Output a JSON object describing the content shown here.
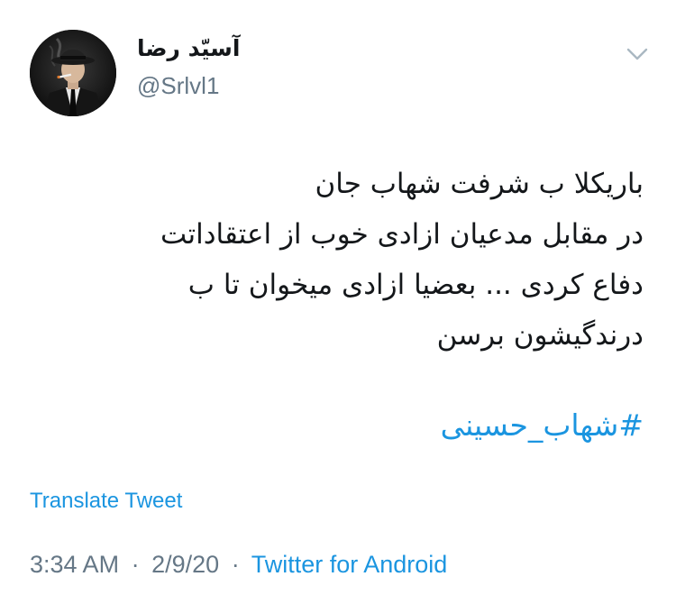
{
  "user": {
    "display_name": "آسیّد رضا",
    "handle": "@Srlvl1"
  },
  "icons": {
    "menu": "chevron-down-icon",
    "avatar": "avatar"
  },
  "tweet": {
    "lines": [
      "باریکلا ب شرفت شهاب جان",
      "در مقابل مدعیان ازادی خوب از اعتقاداتت",
      "دفاع کردی ... بعضیا ازادی میخوان تا ب",
      "درندگیشون برسن"
    ],
    "hashtag": "#شهاب_حسینی",
    "translate_label": "Translate Tweet"
  },
  "meta": {
    "time": "3:34 AM",
    "separator": "·",
    "date": "2/9/20",
    "source": "Twitter for Android"
  },
  "colors": {
    "text": "#14171a",
    "secondary": "#657786",
    "link": "#1b95e0"
  }
}
